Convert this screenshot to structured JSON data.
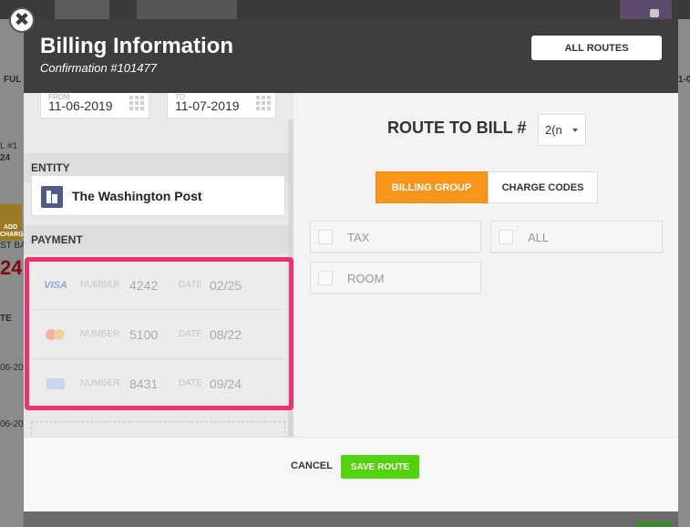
{
  "background": {
    "frag_ful": "FUL",
    "frag_right": "1-0",
    "frag_l1": "L #1",
    "frag_24": "24",
    "frag_add": "ADD",
    "frag_charge": "CHARGE",
    "frag_stba": "ST BA",
    "frag_red": "24",
    "frag_te": "TE",
    "frag_06a": "06-20",
    "frag_06b": "06-20"
  },
  "modal": {
    "title": "Billing Information",
    "subtitle": "Confirmation #101477",
    "all_routes_label": "ALL ROUTES",
    "close_glyph": "✖"
  },
  "dates": {
    "from_label": "FROM",
    "from_value": "11-06-2019",
    "to_label": "TO",
    "to_value": "11-07-2019"
  },
  "entity": {
    "section_label": "ENTITY",
    "name": "The Washington Post",
    "icon": "building-icon"
  },
  "payment": {
    "section_label": "PAYMENT",
    "number_label": "NUMBER",
    "date_label": "DATE",
    "cards": [
      {
        "brand": "VISA",
        "icon": "visa-icon",
        "number": "4242",
        "expiry": "02/25"
      },
      {
        "brand": "",
        "icon": "mastercard-icon",
        "number": "5100",
        "expiry": "08/22"
      },
      {
        "brand": "",
        "icon": "amex-icon",
        "number": "8431",
        "expiry": "09/24"
      }
    ]
  },
  "route": {
    "label": "ROUTE TO BILL #",
    "selected": "2(n"
  },
  "tabs": {
    "billing_group": "BILLING GROUP",
    "charge_codes": "CHARGE CODES"
  },
  "groups": {
    "tax": "TAX",
    "all": "ALL",
    "room": "ROOM"
  },
  "footer": {
    "cancel": "CANCEL",
    "save": "SAVE ROUTE"
  },
  "colors": {
    "accent_orange": "#f7961a",
    "save_green": "#52d20a",
    "highlight_pink": "#f0316d",
    "header_dark": "#3d3e40"
  }
}
